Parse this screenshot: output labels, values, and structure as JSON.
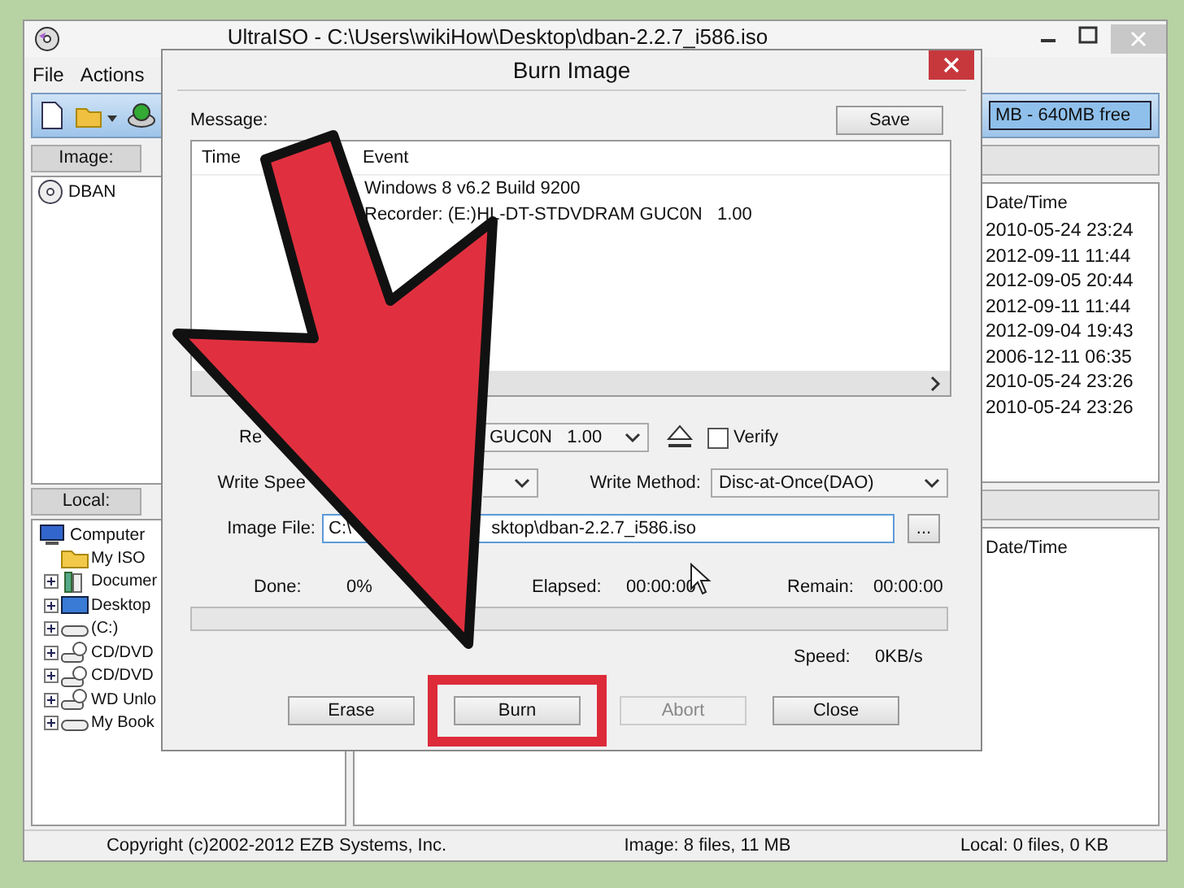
{
  "window": {
    "title": "UltraISO - C:\\Users\\wikiHow\\Desktop\\dban-2.2.7_i586.iso"
  },
  "menu": [
    "File",
    "Actions"
  ],
  "capacity": "MB - 640MB free",
  "image_panel": {
    "label": "Image:",
    "items": [
      "DBAN"
    ]
  },
  "image_files": {
    "column": "Date/Time",
    "rows": [
      "2010-05-24 23:24",
      "2012-09-11 11:44",
      "2012-09-05 20:44",
      "2012-09-11 11:44",
      "2012-09-04 19:43",
      "2006-12-11 06:35",
      "2010-05-24 23:26",
      "2010-05-24 23:26"
    ]
  },
  "local_panel": {
    "label": "Local:",
    "tree": [
      {
        "label": "Computer",
        "kind": "computer",
        "children": [
          {
            "label": "My ISO",
            "kind": "folder",
            "expandable": false
          },
          {
            "label": "Documer",
            "kind": "library",
            "expandable": true
          },
          {
            "label": "Desktop",
            "kind": "desktop",
            "expandable": true
          },
          {
            "label": "(C:)",
            "kind": "drive",
            "expandable": true
          },
          {
            "label": "CD/DVD",
            "kind": "disc-drive",
            "expandable": true
          },
          {
            "label": "CD/DVD",
            "kind": "disc-drive",
            "expandable": true
          },
          {
            "label": "WD Unlo",
            "kind": "disc-drive",
            "expandable": true
          },
          {
            "label": "My Book",
            "kind": "drive",
            "expandable": true
          }
        ]
      }
    ]
  },
  "local_files": {
    "column": "Date/Time"
  },
  "status_bar": [
    "Copyright (c)2002-2012 EZB Systems, Inc.",
    "Image: 8 files, 11 MB",
    "Local: 0 files, 0 KB"
  ],
  "dialog": {
    "title": "Burn Image",
    "message_label": "Message:",
    "save": "Save",
    "log": {
      "columns": [
        "Time",
        "Event"
      ],
      "events": [
        "Windows 8 v6.2 Build 9200",
        "Recorder: (E:)HL-DT-STDVDRAM GUC0N   1.00"
      ]
    },
    "recorder": {
      "label": "Re",
      "value": "GUC0N   1.00"
    },
    "verify": {
      "label": "Verify",
      "checked": false
    },
    "write_speed": {
      "label": "Write Spee"
    },
    "write_method": {
      "label": "Write Method:",
      "value": "Disc-at-Once(DAO)"
    },
    "image_file": {
      "label": "Image File:",
      "value_parts": [
        "C:\\",
        "sktop\\dban-2.2.7_i586.iso"
      ]
    },
    "browse": "...",
    "progress": {
      "done_label": "Done:",
      "done": "0%",
      "elapsed_label": "Elapsed:",
      "elapsed": "00:00:00",
      "remain_label": "Remain:",
      "remain": "00:00:00",
      "level": 0,
      "speed_label": "Speed:",
      "speed": "0KB/s"
    },
    "buttons": [
      {
        "label": "Erase",
        "disabled": false,
        "highlighted": false
      },
      {
        "label": "Burn",
        "disabled": false,
        "highlighted": true
      },
      {
        "label": "Abort",
        "disabled": true,
        "highlighted": false
      },
      {
        "label": "Close",
        "disabled": false,
        "highlighted": false
      }
    ]
  }
}
